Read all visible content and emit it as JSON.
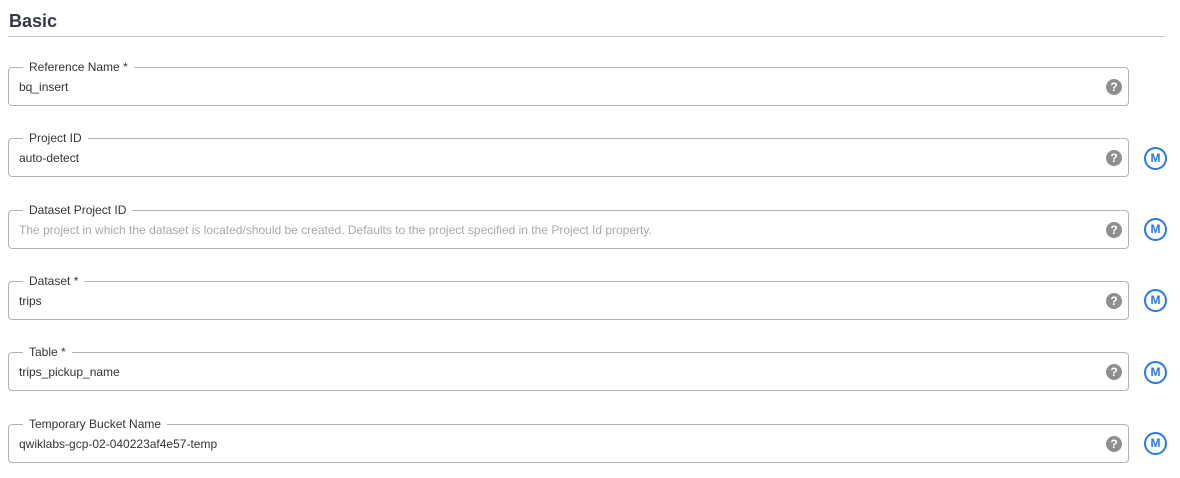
{
  "section": {
    "title": "Basic"
  },
  "help_glyph": "?",
  "macro_glyph": "M",
  "fields": [
    {
      "label": "Reference Name",
      "required_mark": "*",
      "value": "bq_insert",
      "placeholder": ""
    },
    {
      "label": "Project ID",
      "required_mark": "",
      "value": "auto-detect",
      "placeholder": ""
    },
    {
      "label": "Dataset Project ID",
      "required_mark": "",
      "value": "",
      "placeholder": "The project in which the dataset is located/should be created. Defaults to the project specified in the Project Id property."
    },
    {
      "label": "Dataset",
      "required_mark": "*",
      "value": "trips",
      "placeholder": ""
    },
    {
      "label": "Table",
      "required_mark": "*",
      "value": "trips_pickup_name",
      "placeholder": ""
    },
    {
      "label": "Temporary Bucket Name",
      "required_mark": "",
      "value": "qwiklabs-gcp-02-040223af4e57-temp",
      "placeholder": ""
    }
  ],
  "icons": {
    "help": "help-circle-icon",
    "macro": "macro-icon"
  },
  "colors": {
    "macro_accent": "#2a78e4",
    "help_icon": "#8f8f8f",
    "border": "#b3b3b3"
  }
}
